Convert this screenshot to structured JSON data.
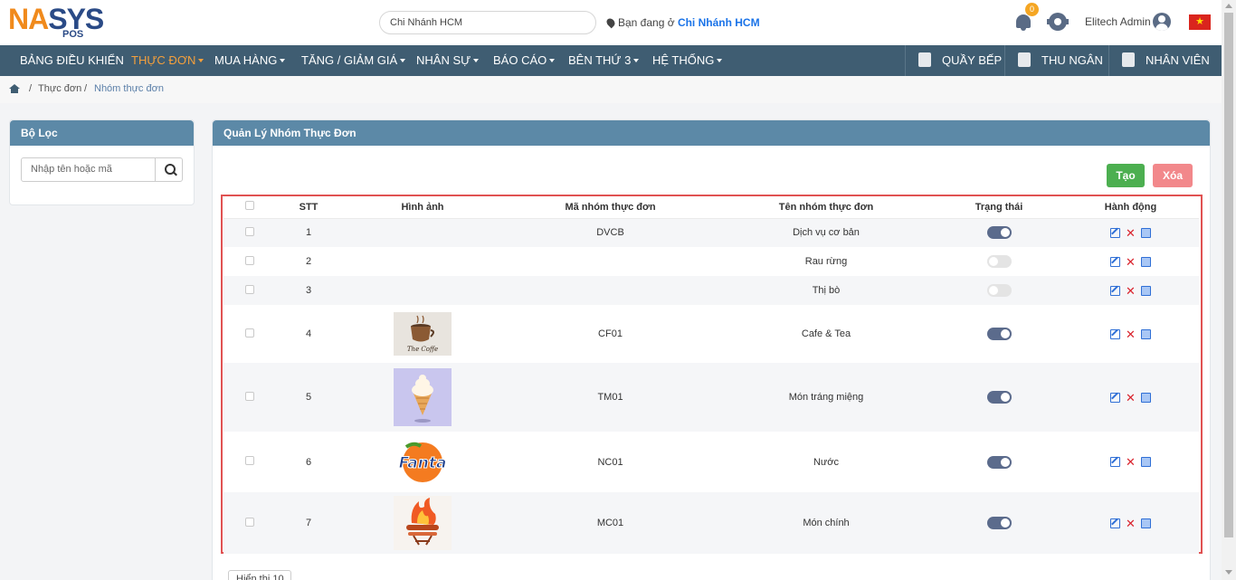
{
  "logo": {
    "part1": "NA",
    "part2": "SYS",
    "sub": "POS"
  },
  "header": {
    "branch_input": "Chi Nhánh HCM",
    "location_prefix": "Bạn đang ở",
    "location_branch": "Chi Nhánh HCM",
    "notification_count": "0",
    "user_name": "Elitech Admin",
    "flag_icon": "vietnam-flag-icon"
  },
  "nav": {
    "items": [
      {
        "label": "BẢNG ĐIỀU KHIỂN",
        "dropdown": false
      },
      {
        "label": "THỰC ĐƠN",
        "dropdown": true,
        "active": true
      },
      {
        "label": "MUA HÀNG",
        "dropdown": true
      },
      {
        "label": "TĂNG / GIẢM GIÁ",
        "dropdown": true
      },
      {
        "label": "NHÂN SỰ",
        "dropdown": true
      },
      {
        "label": "BÁO CÁO",
        "dropdown": true
      },
      {
        "label": "BÊN THỨ 3",
        "dropdown": true
      },
      {
        "label": "HỆ THỐNG",
        "dropdown": true
      }
    ],
    "right": [
      {
        "label": "QUẦY BẾP",
        "icon": "chef-icon"
      },
      {
        "label": "THU NGÂN",
        "icon": "cashier-icon"
      },
      {
        "label": "NHÂN VIÊN",
        "icon": "clipboard-icon"
      }
    ],
    "active_color": "#f5a03c",
    "bar_color": "#3f5d72"
  },
  "breadcrumb": {
    "level1": "Thực đơn",
    "sep": "/",
    "level2": "Nhóm thực đơn"
  },
  "filter": {
    "title": "Bộ Lọc",
    "placeholder": "Nhập tên hoặc mã"
  },
  "main": {
    "title": "Quản Lý Nhóm Thực Đơn",
    "create_label": "Tạo",
    "delete_label": "Xóa",
    "columns": [
      "STT",
      "Hình ảnh",
      "Mã nhóm thực đơn",
      "Tên nhóm thực đơn",
      "Trạng thái",
      "Hành động"
    ],
    "rows": [
      {
        "stt": "1",
        "image": "",
        "code": "DVCB",
        "name": "Dịch vụ cơ bản",
        "active": true
      },
      {
        "stt": "2",
        "image": "",
        "code": "",
        "name": "Rau rừng",
        "active": false
      },
      {
        "stt": "3",
        "image": "",
        "code": "",
        "name": "Thị bò",
        "active": false
      },
      {
        "stt": "4",
        "image": "coffee-cup-image",
        "image_text": "The Coffe",
        "code": "CF01",
        "name": "Cafe & Tea",
        "active": true
      },
      {
        "stt": "5",
        "image": "ice-cream-image",
        "code": "TM01",
        "name": "Món tráng miệng",
        "active": true
      },
      {
        "stt": "6",
        "image": "fanta-logo-image",
        "image_text": "Fanta",
        "code": "NC01",
        "name": "Nước",
        "active": true
      },
      {
        "stt": "7",
        "image": "grill-image",
        "code": "MC01",
        "name": "Món chính",
        "active": true
      }
    ],
    "pager_label": "Hiển thị 10"
  }
}
